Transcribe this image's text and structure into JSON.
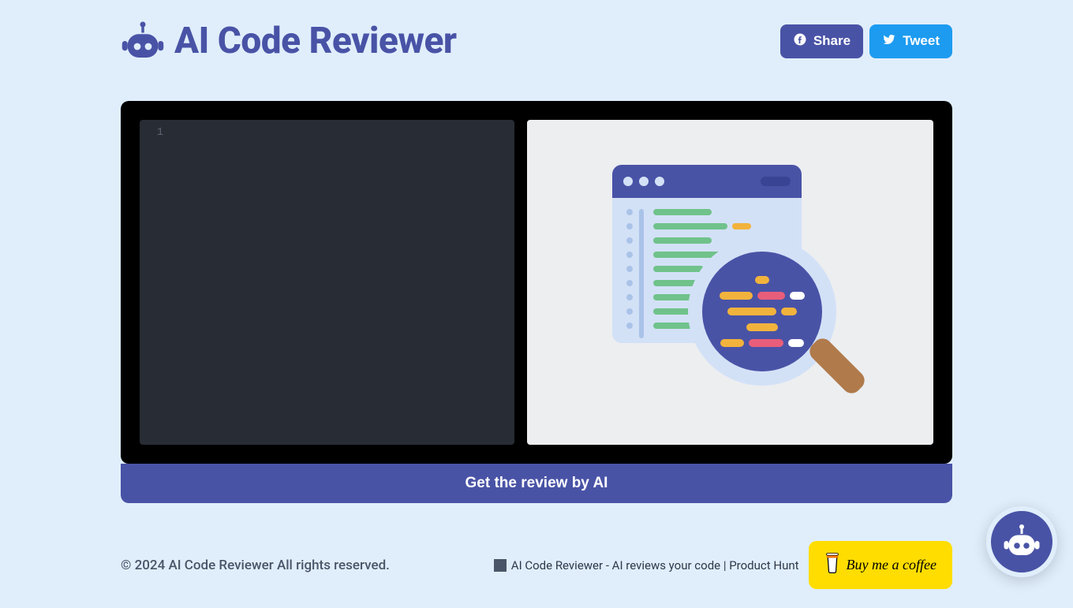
{
  "header": {
    "title": "AI Code Reviewer",
    "logo_icon": "robot-icon",
    "share_label": "Share",
    "tweet_label": "Tweet"
  },
  "editor": {
    "line_number": "1",
    "code_value": ""
  },
  "cta": {
    "label": "Get the review by AI"
  },
  "footer": {
    "copyright": "© 2024 AI Code Reviewer All rights reserved.",
    "producthunt_alt": "AI Code Reviewer - AI reviews your code | Product Hunt",
    "coffee_label": "Buy me a coffee"
  },
  "colors": {
    "brand": "#4953a6",
    "twitter": "#1d9bf0",
    "coffee": "#ffdd00",
    "editor_bg": "#282c34",
    "page_bg": "#e0eefc"
  }
}
